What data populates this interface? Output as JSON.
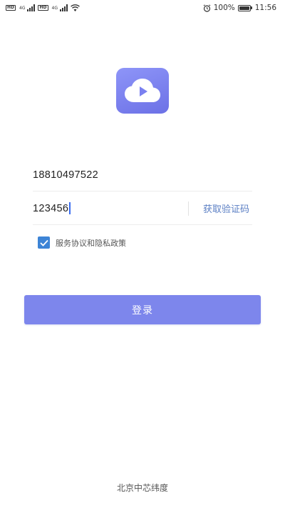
{
  "status_bar": {
    "sim1_hd": "HD",
    "sim1_net": "4G",
    "sim2_hd": "HD",
    "sim2_net": "4G",
    "battery": "100%",
    "time": "11:56"
  },
  "logo": {
    "icon": "cloud-play-icon",
    "color": "#7a80f0"
  },
  "form": {
    "phone_value": "18810497522",
    "code_value": "123456",
    "get_code_label": "获取验证码"
  },
  "agreement": {
    "checked": true,
    "label": "服务协议和隐私政策"
  },
  "login": {
    "label": "登录",
    "color": "#7d86ec"
  },
  "footer": {
    "text": "北京中芯纬度"
  }
}
